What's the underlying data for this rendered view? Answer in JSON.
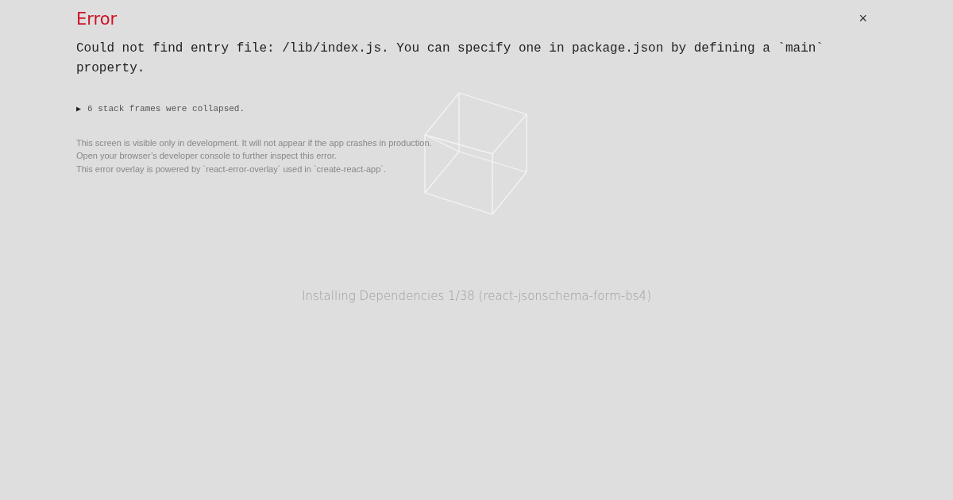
{
  "loader": {
    "status": "Installing Dependencies 1/38 (react-jsonschema-form-bs4)"
  },
  "error_overlay": {
    "title": "Error",
    "close": "×",
    "message": "Could not find entry file: /lib/index.js. You can specify one in package.json by defining a `main` property.",
    "stack_toggle": {
      "icon": "▶",
      "label": "6 stack frames were collapsed."
    },
    "footer_lines": [
      "This screen is visible only in development. It will not appear if the app crashes in production.",
      "Open your browser’s developer console to further inspect this error.",
      "This error overlay is powered by `react-error-overlay` used in `create-react-app`."
    ]
  }
}
